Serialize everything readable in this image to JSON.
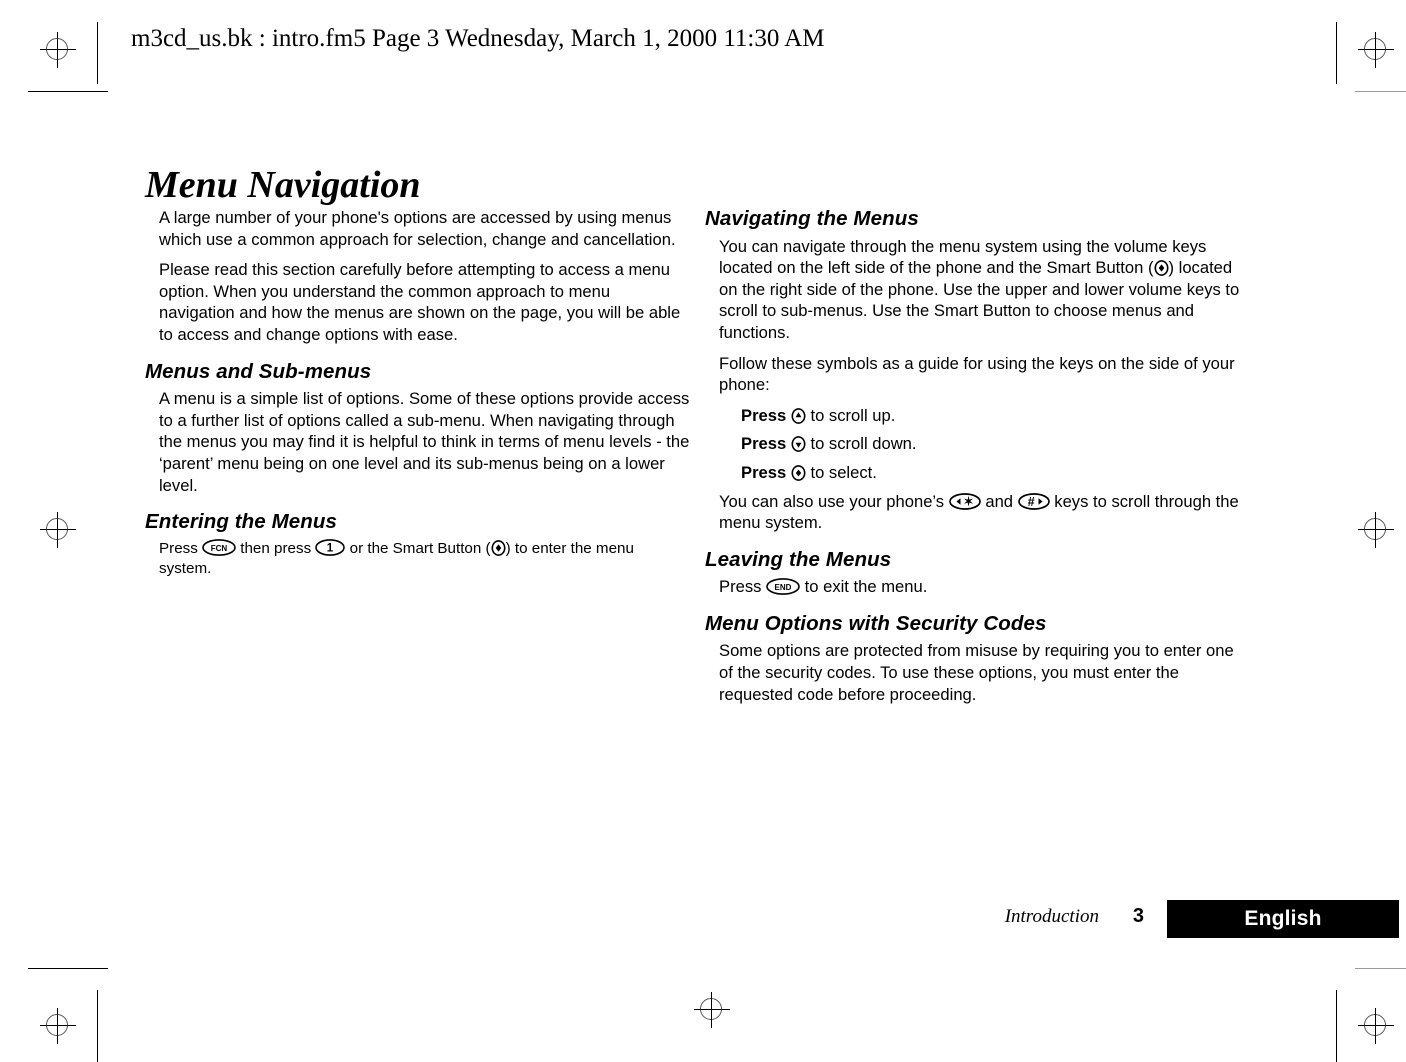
{
  "header": {
    "text": "m3cd_us.bk : intro.fm5  Page 3  Wednesday, March 1, 2000  11:30 AM"
  },
  "page": {
    "title": "Menu Navigation"
  },
  "left_column": {
    "intro_paragraph_1": "A large number of your phone's options are accessed by using menus which use a common approach for selection, change and cancellation.",
    "intro_paragraph_2": "Please read this section carefully before attempting to access a menu option. When you understand the common approach to menu navigation and how the menus are shown on the page, you will be able to access and change options with ease.",
    "section_menus_heading": "Menus and Sub-menus",
    "section_menus_paragraph": "A menu is a simple list of options. Some of these options provide access to a further list of options called a sub-menu. When navigating through the menus you may find it is helpful to think in terms of menu levels - the ‘parent’ menu being on one level and its sub-menus being on a lower level.",
    "section_entering_heading": "Entering the Menus",
    "entering_text_1": "Press ",
    "entering_text_2": " then press ",
    "entering_text_3": " or the Smart Button (",
    "entering_text_4": ") to enter the menu system."
  },
  "right_column": {
    "section_navigating_heading": "Navigating the Menus",
    "navigating_text_1": "You can navigate through the menu system using the volume keys located on the left side of the phone and the Smart Button (",
    "navigating_text_2": ") located on the right side of the phone. Use the upper and lower volume keys to scroll to sub-menus. Use the Smart Button to choose menus and functions.",
    "follow_symbols_paragraph": "Follow these symbols as a guide for using the keys on the side of your phone:",
    "press_up_label": "Press",
    "press_up_action": " to scroll up.",
    "press_down_label": "Press",
    "press_down_action": " to scroll down.",
    "press_select_label": "Press",
    "press_select_action": " to select.",
    "also_use_text_1": "You can also use your phone’s ",
    "also_use_text_2": " and ",
    "also_use_text_3": " keys to scroll through the menu system.",
    "section_leaving_heading": "Leaving the Menus",
    "leaving_text_1": "Press ",
    "leaving_text_2": " to exit the menu.",
    "section_security_heading": "Menu Options with Security Codes",
    "security_paragraph": "Some options are protected from misuse by requiring you to enter one of the security codes. To use these options, you must enter the requested code before proceeding."
  },
  "keys": {
    "fcn_label": "FCN",
    "one_label": "1",
    "end_label": "END",
    "star_label": "✶",
    "hash_label": "#",
    "smart_button_name": "smart-button",
    "scroll_up_name": "scroll-up-key",
    "scroll_down_name": "scroll-down-key"
  },
  "footer": {
    "chapter": "Introduction",
    "page_number": "3",
    "language": "English"
  },
  "colors": {
    "ink": "#000000",
    "paper": "#ffffff",
    "lang_bar_bg": "#000000",
    "lang_bar_text": "#ffffff",
    "reg_mark": "#555555"
  }
}
